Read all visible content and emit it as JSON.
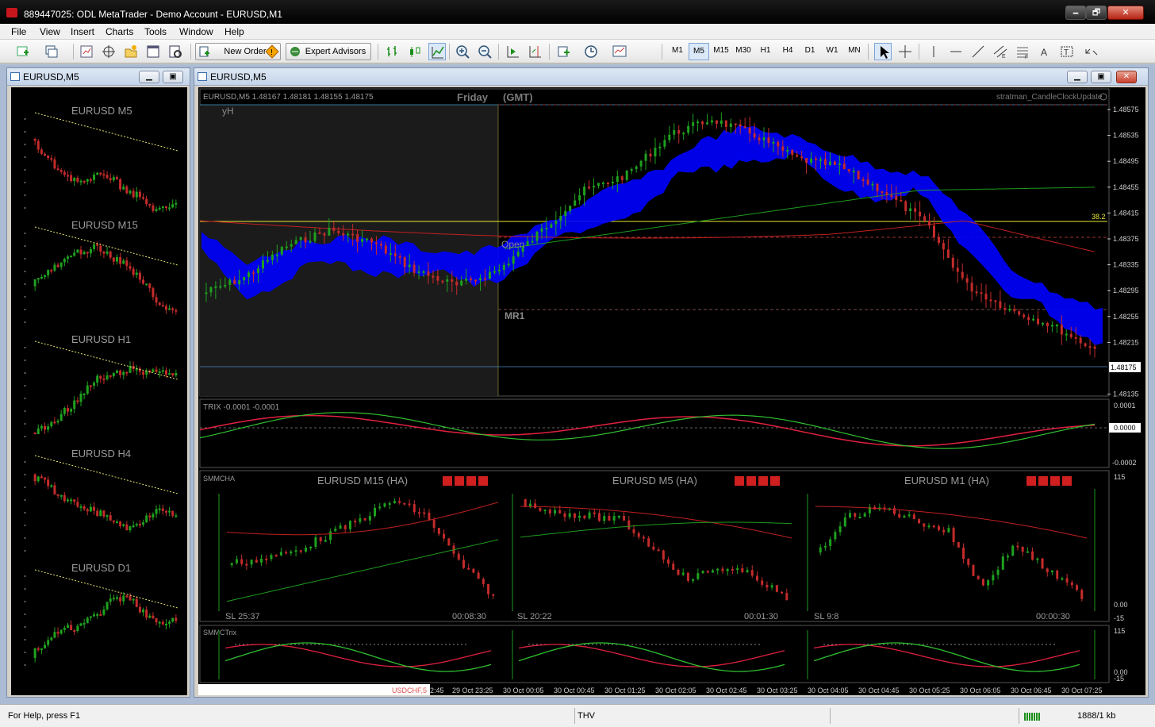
{
  "window": {
    "title": "889447025: ODL MetaTrader - Demo Account - EURUSD,M1",
    "min_label": "🗕",
    "max_label": "🗗",
    "close_label": "✕"
  },
  "menu": [
    "File",
    "View",
    "Insert",
    "Charts",
    "Tools",
    "Window",
    "Help"
  ],
  "toolbar": {
    "new_order": "New Order",
    "expert_advisors": "Expert Advisors",
    "timeframes": [
      "M1",
      "M5",
      "M15",
      "M30",
      "H1",
      "H4",
      "D1",
      "W1",
      "MN"
    ],
    "active_timeframe": "M5"
  },
  "left_chart": {
    "title": "EURUSD,M5",
    "panels": [
      "EURUSD M5",
      "EURUSD M15",
      "EURUSD H1",
      "EURUSD H4",
      "EURUSD D1"
    ]
  },
  "main_chart": {
    "title": "EURUSD,M5",
    "ohlc_label": "EURUSD,M5  1.48167 1.48181 1.48155 1.48175",
    "day_label": "Friday",
    "tz_label": "(GMT)",
    "indicator_label": "stratman_CandleClockUpdate",
    "yh_label": "yH",
    "open_label": "Open",
    "mr1_label": "MR1",
    "fib_label": "38.2",
    "current_price": "1.48175",
    "price_ticks": [
      "1.48575",
      "1.48535",
      "1.48495",
      "1.48455",
      "1.48415",
      "1.48375",
      "1.48335",
      "1.48295",
      "1.48255",
      "1.48215",
      "1.48175",
      "1.48135"
    ],
    "trix": {
      "label": "TRIX -0.0001 -0.0001",
      "ticks": [
        "0.0001",
        "0.0000",
        "-0.0002"
      ]
    },
    "smmcha": {
      "label": "SMMCHA",
      "panels": [
        {
          "title": "EURUSD M15 (HA)",
          "sl": "SL 25:37",
          "clock": "00:08:30"
        },
        {
          "title": "EURUSD M5 (HA)",
          "sl": "SL 20:22",
          "clock": "00:01:30"
        },
        {
          "title": "EURUSD M1 (HA)",
          "sl": "SL 9:8",
          "clock": "00:00:30"
        }
      ],
      "ticks": [
        "115",
        "0.00",
        "-15"
      ]
    },
    "smmctrix": {
      "label": "SMMCTrix",
      "ticks": [
        "115",
        "0.00",
        "-15"
      ]
    },
    "time_labels": [
      "2:45",
      "29 Oct 23:25",
      "30 Oct 00:05",
      "30 Oct 00:45",
      "30 Oct 01:25",
      "30 Oct 02:05",
      "30 Oct 02:45",
      "30 Oct 03:25",
      "30 Oct 04:05",
      "30 Oct 04:45",
      "30 Oct 05:25",
      "30 Oct 06:05",
      "30 Oct 06:45",
      "30 Oct 07:25"
    ],
    "tab_label": "USDCHF,5"
  },
  "status": {
    "help": "For Help, press F1",
    "profile": "THV",
    "traffic": "1888/1 kb"
  },
  "colors": {
    "bull": "#1fa11f",
    "bear": "#c42b2b",
    "cloud": "#0000ff",
    "ma_red": "#c02020",
    "ma_green": "#1e9a1e"
  }
}
